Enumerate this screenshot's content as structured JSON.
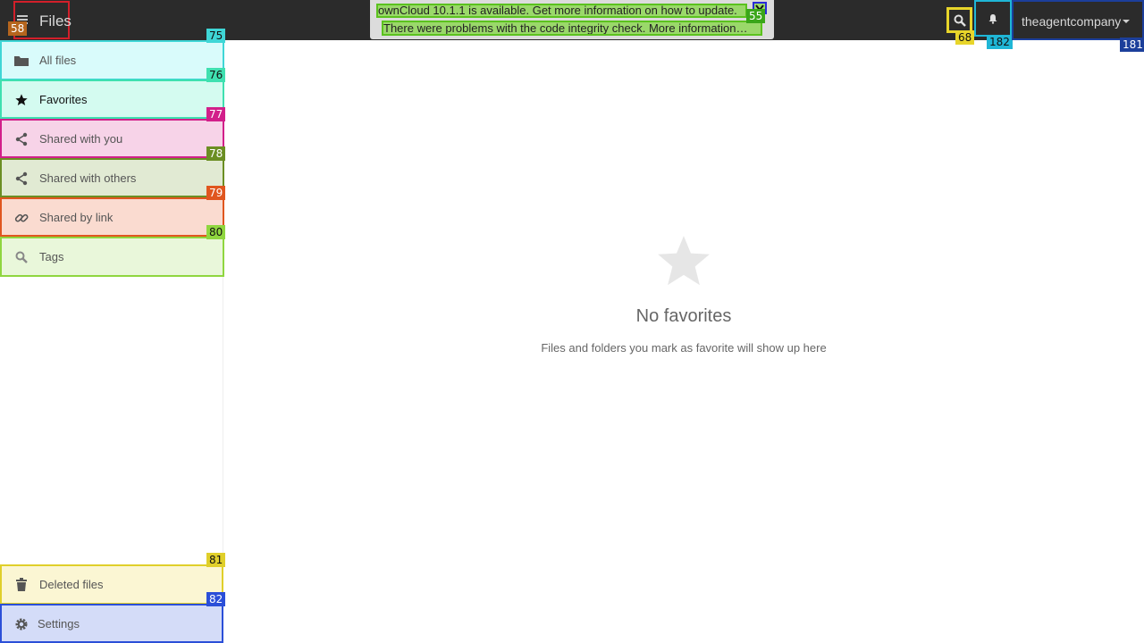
{
  "header": {
    "app_title": "Files",
    "user_name": "theagentcompany"
  },
  "banner": {
    "update_message": "ownCloud 10.1.1 is available. Get more information on how to update.",
    "integrity_message": "There were problems with the code integrity check. More information…"
  },
  "sidebar": {
    "items": [
      {
        "label": "All files",
        "icon": "folder-icon",
        "tag": "75"
      },
      {
        "label": "Favorites",
        "icon": "star-icon",
        "tag": "76"
      },
      {
        "label": "Shared with you",
        "icon": "share-icon",
        "tag": "77"
      },
      {
        "label": "Shared with others",
        "icon": "share-icon",
        "tag": "78"
      },
      {
        "label": "Shared by link",
        "icon": "link-icon",
        "tag": "79"
      },
      {
        "label": "Tags",
        "icon": "search-icon",
        "tag": "80"
      }
    ],
    "bottom_items": [
      {
        "label": "Deleted files",
        "icon": "trash-icon",
        "tag": "81"
      },
      {
        "label": "Settings",
        "icon": "gear-icon",
        "tag": "82"
      }
    ]
  },
  "labels": {
    "app_menu": "58",
    "banner": "55",
    "search": "68",
    "notifications": "182",
    "user": "181"
  },
  "content": {
    "empty_title": "No favorites",
    "empty_hint": "Files and folders you mark as favorite will show up here"
  },
  "colors": {
    "header_bg": "#2b2b2b",
    "app_menu_box": "#d21f2a",
    "banner_msg": "#9ad86a",
    "search_box": "#e8d52a",
    "notif_box": "#1fb6d6",
    "user_box": "#1c3f9b"
  }
}
